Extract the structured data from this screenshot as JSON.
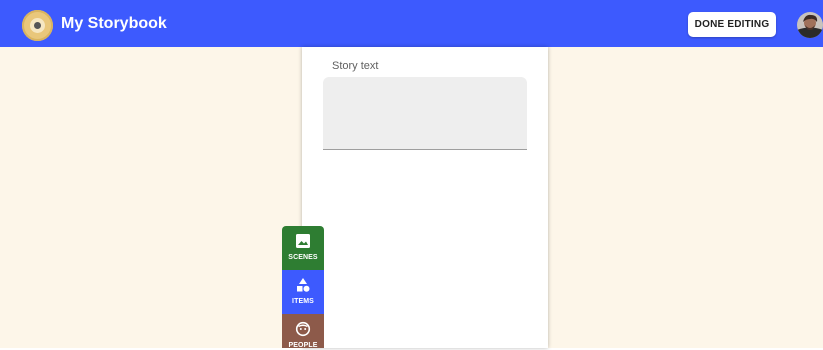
{
  "header": {
    "logo_icon": "storybook-logo-icon",
    "title": "My Storybook",
    "done_label": "DONE EDITING",
    "avatar_icon": "user-avatar-icon",
    "background": "#3d5afe"
  },
  "editor": {
    "canvas_background": "#fdf6e9",
    "story_label": "Story text",
    "story_value": ""
  },
  "toolbox": {
    "scenes": {
      "label": "SCENES",
      "icon": "image-icon",
      "color": "#2e7d32"
    },
    "items": {
      "label": "ITEMS",
      "icon": "shapes-icon",
      "color": "#3d5afe"
    },
    "people": {
      "label": "PEOPLE",
      "icon": "face-icon",
      "color": "#8d5a4a"
    }
  }
}
